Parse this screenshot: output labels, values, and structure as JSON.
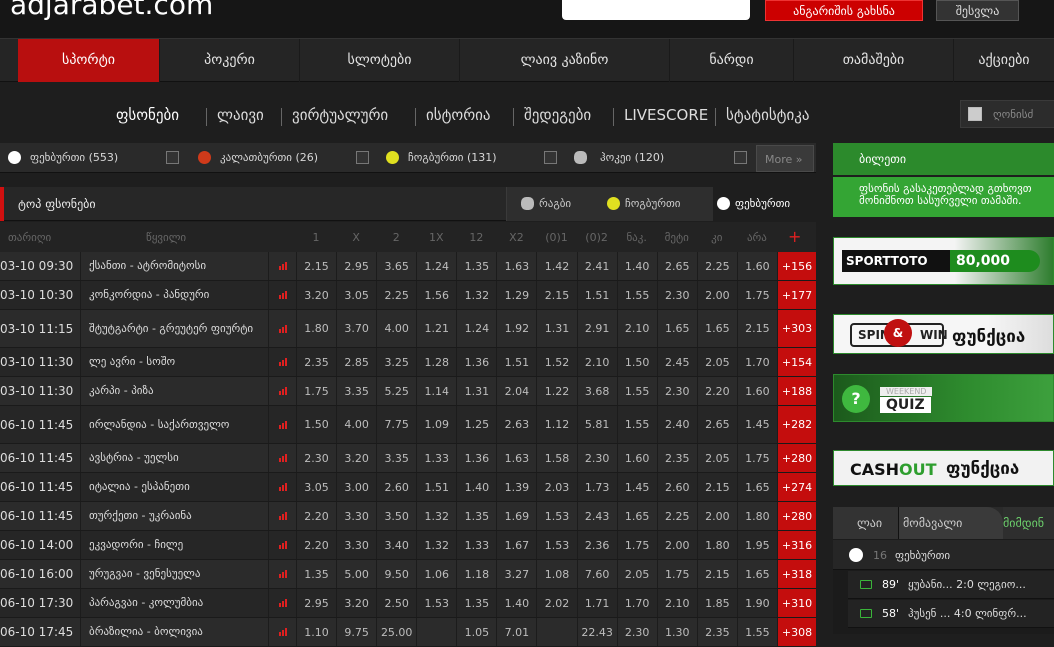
{
  "header": {
    "logo": "adjarabet.com",
    "register_label": "ანგარიშის გახსნა",
    "login_label": "შესვლა"
  },
  "main_nav": [
    "სპორტი",
    "პოკერი",
    "სლოტები",
    "ლაივ კაზინო",
    "ნარდი",
    "თამაშები",
    "აქციები"
  ],
  "sub_nav": [
    "ფსონები",
    "ლაივი",
    "ვირტუალური",
    "ისტორია",
    "შედეგები",
    "LIVESCORE",
    "სტატისტიკა"
  ],
  "search": {
    "placeholder": "ღონისძ"
  },
  "sport_tabs": [
    {
      "label": "ფეხბურთი (553)",
      "icon": "football-icon",
      "color": "#ffffff"
    },
    {
      "label": "კალათბურთი (26)",
      "icon": "basketball-icon",
      "color": "#d03a1a"
    },
    {
      "label": "ჩოგბურთი (131)",
      "icon": "tennis-icon",
      "color": "#e0e020"
    },
    {
      "label": "ჰოკეი (120)",
      "icon": "hockey-icon",
      "color": "#bbbbbb"
    }
  ],
  "more_label": "More",
  "top_bets": {
    "title": "ტოპ ფსონები",
    "tabs": [
      {
        "label": "რაგბი",
        "icon": "rugby-icon"
      },
      {
        "label": "ჩოგბურთი",
        "icon": "tennis-icon"
      },
      {
        "label": "ფეხბურთი",
        "icon": "football-icon"
      }
    ]
  },
  "columns": {
    "date": "თარიღი",
    "event": "წყვილი",
    "odds": [
      "1",
      "X",
      "2",
      "1X",
      "12",
      "X2",
      "(0)1",
      "(0)2",
      "ნაკ.",
      "მეტი",
      "კი",
      "არა"
    ],
    "plus": "+"
  },
  "matches": [
    {
      "date": "03-10 09:30",
      "name": "ქსანთი - ატრომიტოსი",
      "odds": [
        "2.15",
        "2.95",
        "3.65",
        "1.24",
        "1.35",
        "1.63",
        "1.42",
        "2.41",
        "1.40",
        "2.65",
        "2.25",
        "1.60"
      ],
      "more": "+156"
    },
    {
      "date": "03-10 10:30",
      "name": "კონკორდია - პანდური",
      "odds": [
        "3.20",
        "3.05",
        "2.25",
        "1.56",
        "1.32",
        "1.29",
        "2.15",
        "1.51",
        "1.55",
        "2.30",
        "2.00",
        "1.75"
      ],
      "more": "+177"
    },
    {
      "date": "03-10 11:15",
      "name": "შტუტგარტი - გრეუტერ ფიურტი",
      "odds": [
        "1.80",
        "3.70",
        "4.00",
        "1.21",
        "1.24",
        "1.92",
        "1.31",
        "2.91",
        "2.10",
        "1.65",
        "1.65",
        "2.15"
      ],
      "more": "+303"
    },
    {
      "date": "03-10 11:30",
      "name": "ლე ავრი - სოშო",
      "odds": [
        "2.35",
        "2.85",
        "3.25",
        "1.28",
        "1.36",
        "1.51",
        "1.52",
        "2.10",
        "1.50",
        "2.45",
        "2.05",
        "1.70"
      ],
      "more": "+154"
    },
    {
      "date": "03-10 11:30",
      "name": "კარპი - პიზა",
      "odds": [
        "1.75",
        "3.35",
        "5.25",
        "1.14",
        "1.31",
        "2.04",
        "1.22",
        "3.68",
        "1.55",
        "2.30",
        "2.20",
        "1.60"
      ],
      "more": "+188"
    },
    {
      "date": "06-10 11:45",
      "name": "ირლანდია - საქართველო",
      "odds": [
        "1.50",
        "4.00",
        "7.75",
        "1.09",
        "1.25",
        "2.63",
        "1.12",
        "5.81",
        "1.55",
        "2.40",
        "2.65",
        "1.45"
      ],
      "more": "+282"
    },
    {
      "date": "06-10 11:45",
      "name": "ავსტრია - უელსი",
      "odds": [
        "2.30",
        "3.20",
        "3.35",
        "1.33",
        "1.36",
        "1.63",
        "1.58",
        "2.30",
        "1.60",
        "2.35",
        "2.05",
        "1.75"
      ],
      "more": "+280"
    },
    {
      "date": "06-10 11:45",
      "name": "იტალია - ესპანეთი",
      "odds": [
        "3.05",
        "3.00",
        "2.60",
        "1.51",
        "1.40",
        "1.39",
        "2.03",
        "1.73",
        "1.45",
        "2.60",
        "2.15",
        "1.65"
      ],
      "more": "+274"
    },
    {
      "date": "06-10 11:45",
      "name": "თურქეთი - უკრაინა",
      "odds": [
        "2.20",
        "3.30",
        "3.50",
        "1.32",
        "1.35",
        "1.69",
        "1.53",
        "2.43",
        "1.65",
        "2.25",
        "2.00",
        "1.80"
      ],
      "more": "+280"
    },
    {
      "date": "06-10 14:00",
      "name": "ეკვადორი - ჩილე",
      "odds": [
        "2.20",
        "3.30",
        "3.40",
        "1.32",
        "1.33",
        "1.67",
        "1.53",
        "2.36",
        "1.75",
        "2.00",
        "1.80",
        "1.95"
      ],
      "more": "+316"
    },
    {
      "date": "06-10 16:00",
      "name": "ურუგვაი - ვენესუელა",
      "odds": [
        "1.35",
        "5.00",
        "9.50",
        "1.06",
        "1.18",
        "3.27",
        "1.08",
        "7.60",
        "2.05",
        "1.75",
        "2.15",
        "1.65"
      ],
      "more": "+318"
    },
    {
      "date": "06-10 17:30",
      "name": "პარაგვაი - კოლუმბია",
      "odds": [
        "2.95",
        "3.20",
        "2.50",
        "1.53",
        "1.35",
        "1.40",
        "2.02",
        "1.71",
        "1.70",
        "2.10",
        "1.85",
        "1.90"
      ],
      "more": "+310"
    },
    {
      "date": "06-10 17:45",
      "name": "ბრაზილია - ბოლივია",
      "odds": [
        "1.10",
        "9.75",
        "25.00",
        "",
        "1.05",
        "7.01",
        "",
        "22.43",
        "2.30",
        "1.30",
        "2.35",
        "1.55"
      ],
      "more": "+308"
    }
  ],
  "betslip": {
    "title": "ბილეთი",
    "info": "ფსონის გასაკეთებლად გთხოვთ მონიშნოთ სასურველი თამაში."
  },
  "banners": {
    "sporttoto": {
      "logo": "SPORTTOTO",
      "amount": "80,000"
    },
    "spinwin": {
      "left": "SPIN",
      "amp": "&",
      "right": "WIN",
      "feature": "ფუნქცია"
    },
    "quiz": {
      "mark": "?",
      "weekend": "WEEKEND",
      "quiz": "QUIZ"
    },
    "cashout": {
      "cash": "CASH",
      "out": "OUT",
      "feature": "ფუნქცია"
    }
  },
  "live_box": {
    "tabs": [
      "ლაი",
      "მომავალი",
      "მიმდინ"
    ],
    "sport": {
      "count": "16",
      "name": "ფეხბურთი"
    },
    "rows": [
      {
        "minute": "89'",
        "match": "ყუბანი... 2:0 ლეგიო..."
      },
      {
        "minute": "58'",
        "match": "ჰუსენ ... 4:0 ლინფრ..."
      }
    ]
  }
}
